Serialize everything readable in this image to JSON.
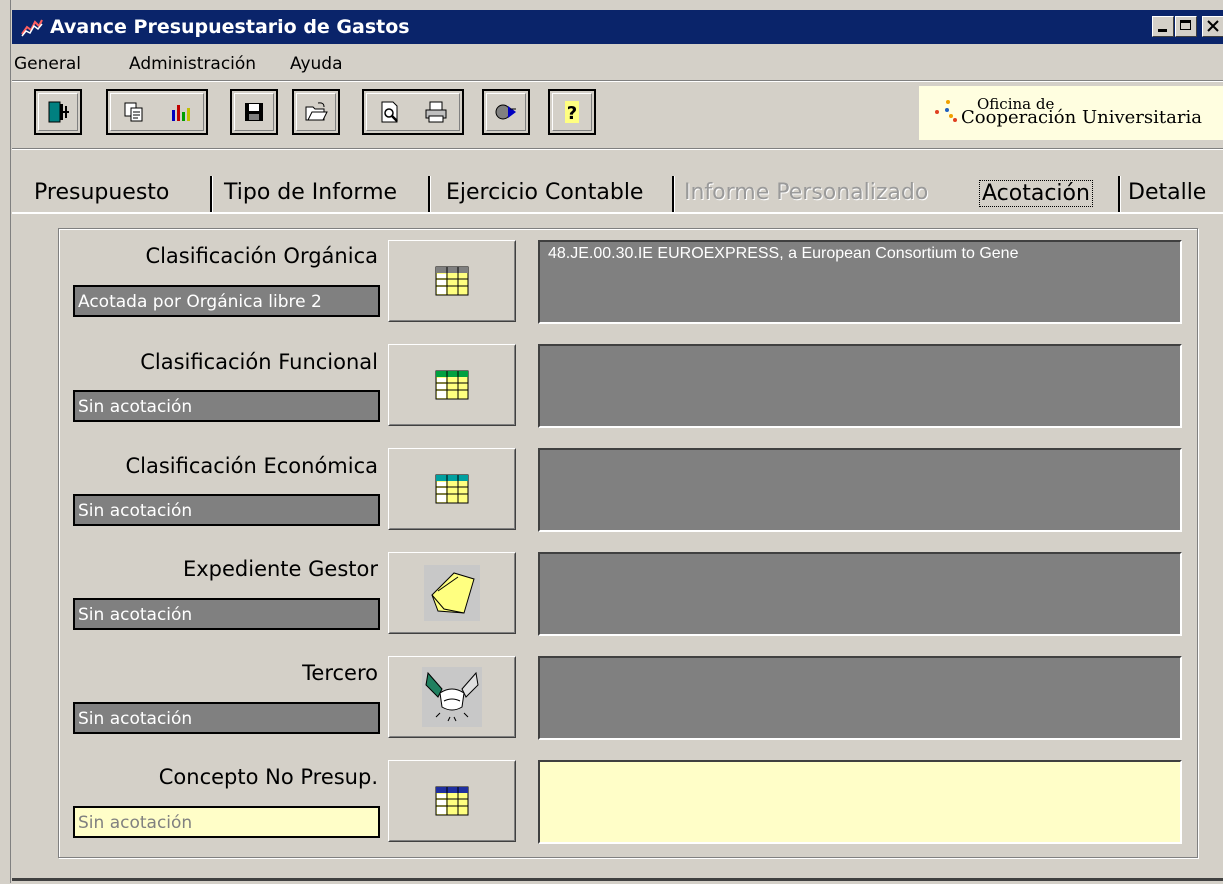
{
  "window": {
    "title": "Avance Presupuestario de Gastos",
    "title_bar_color": "#0a246a"
  },
  "menu": [
    "General",
    "Administración",
    "Ayuda"
  ],
  "toolbar": {
    "buttons": [
      {
        "name": "exit",
        "icon": "exit-door-icon"
      },
      {
        "name": "copy-chart",
        "icons": [
          "copy-icon",
          "bar-chart-icon"
        ]
      },
      {
        "name": "save",
        "icon": "floppy-disk-icon"
      },
      {
        "name": "open",
        "icon": "open-folder-icon"
      },
      {
        "name": "preview-print",
        "icons": [
          "print-preview-icon",
          "printer-icon"
        ]
      },
      {
        "name": "refresh",
        "icon": "refresh-icon"
      },
      {
        "name": "help",
        "icon": "question-mark-icon"
      }
    ],
    "logo": {
      "line1": "Oficina de",
      "line2": "Cooperación Universitaria"
    }
  },
  "tabs": [
    {
      "label": "Presupuesto",
      "state": "normal"
    },
    {
      "label": "Tipo de Informe",
      "state": "normal"
    },
    {
      "label": "Ejercicio Contable",
      "state": "normal"
    },
    {
      "label": "Informe Personalizado",
      "state": "disabled"
    },
    {
      "label": "Acotación",
      "state": "active"
    },
    {
      "label": "Detalle",
      "state": "normal"
    }
  ],
  "rows": [
    {
      "label": "Clasificación Orgánica",
      "status": "Acotada por Orgánica libre 2",
      "value": "48.JE.00.30.IE EUROEXPRESS,  a European Consortium to Gene",
      "icon": "table-grid-icon"
    },
    {
      "label": "Clasificación Funcional",
      "status": "Sin acotación",
      "value": "",
      "icon": "table-grid-green-icon"
    },
    {
      "label": "Clasificación Económica",
      "status": "Sin acotación",
      "value": "",
      "icon": "table-grid-cyan-icon"
    },
    {
      "label": "Expediente Gestor",
      "status": "Sin acotación",
      "value": "",
      "icon": "folder-icon"
    },
    {
      "label": "Tercero",
      "status": "Sin acotación",
      "value": "",
      "icon": "handshake-icon"
    },
    {
      "label": "Concepto No Presup.",
      "status": "Sin acotación",
      "value": "",
      "icon": "table-grid-blue-icon"
    }
  ],
  "colors": {
    "field_gray": "#808080",
    "field_yellow": "#fffec8",
    "face": "#d4d0c8"
  }
}
